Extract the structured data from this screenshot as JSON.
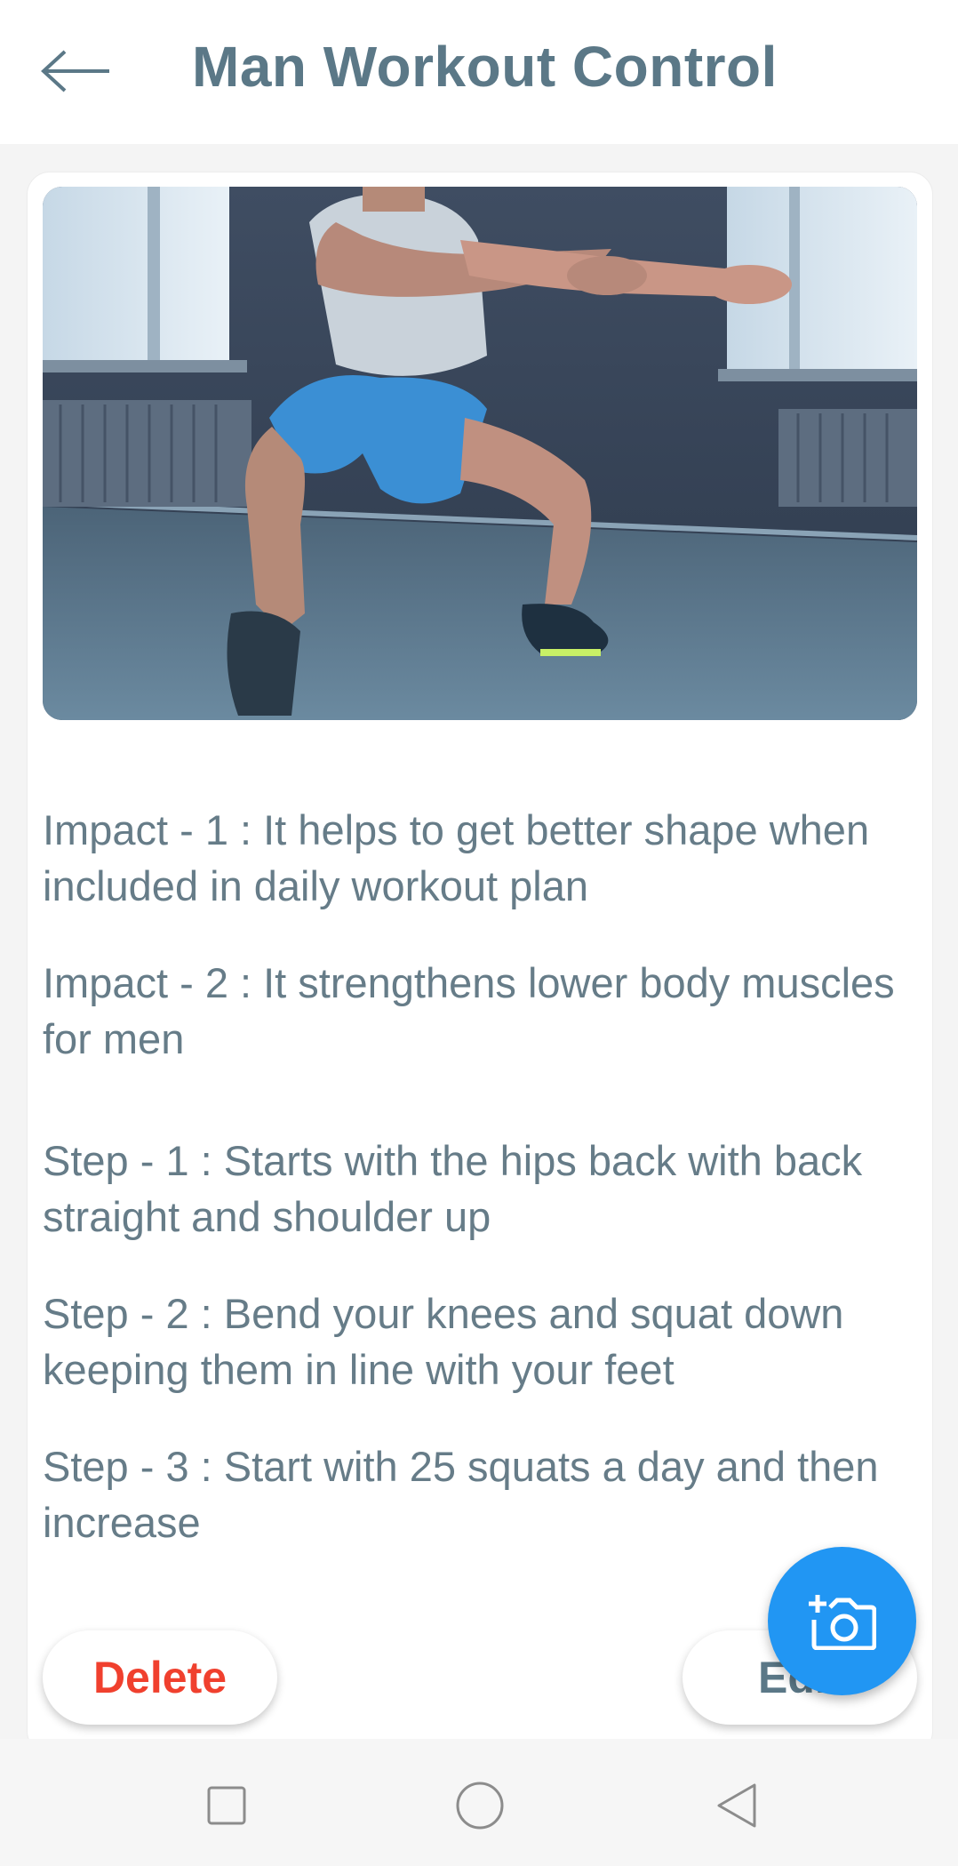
{
  "header": {
    "title": "Man Workout Control",
    "back_icon": "arrow-left-icon"
  },
  "card": {
    "image_alt": "man doing squat exercise",
    "impacts": [
      "Impact - 1 :  It helps to get better shape when included in daily workout plan",
      "Impact - 2 :  It strengthens lower body muscles for men"
    ],
    "steps": [
      "Step - 1 :  Starts with the hips back with back straight and shoulder up",
      "Step - 2 :  Bend your knees and squat down keeping them in line with your feet",
      "Step - 3 :  Start with 25 squats a day and then increase"
    ],
    "delete_label": "Delete",
    "edit_label": "Edit"
  },
  "fab": {
    "icon": "add-photo-camera-icon"
  },
  "nav": {
    "recent_icon": "square-recent-icon",
    "home_icon": "circle-home-icon",
    "back_icon": "triangle-back-icon"
  },
  "colors": {
    "title": "#5b7887",
    "body_text": "#667c88",
    "delete": "#f0402e",
    "fab": "#2196f3"
  }
}
